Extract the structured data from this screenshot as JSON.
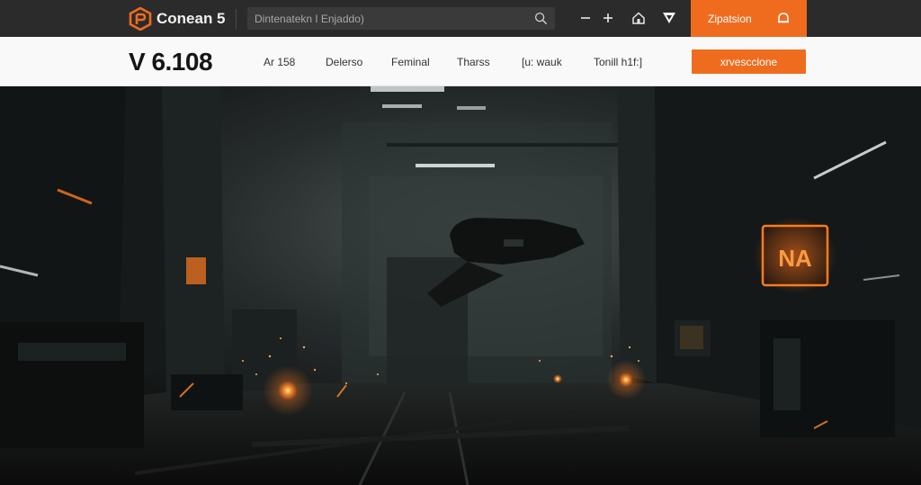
{
  "topbar": {
    "logo_icon": "hex-logo-icon",
    "brand": "Conean 5",
    "search": {
      "placeholder": "Dintenatekn ǀ Enjaddo)"
    },
    "icons": [
      "search-icon",
      "minus-icon",
      "plus-icon",
      "home-icon",
      "send-icon",
      "bell-icon"
    ],
    "action_button": {
      "label": "Zipatsion"
    }
  },
  "header": {
    "version": "V 6.108",
    "nav": [
      "Ar 158",
      "Delerso",
      "Feminal",
      "Tharss",
      "[u: wauk",
      "Tonill h1f:]"
    ],
    "cta_label": "xrvescclone"
  },
  "hero": {
    "sign_text": "NA",
    "accent": "#ef6c1e",
    "scene": "dark-industrial-hangar"
  },
  "colors": {
    "topbar_bg": "#2b2b2b",
    "navbar_bg": "#f9f9f9",
    "accent": "#ef6c1e",
    "text_dark": "#151515"
  }
}
